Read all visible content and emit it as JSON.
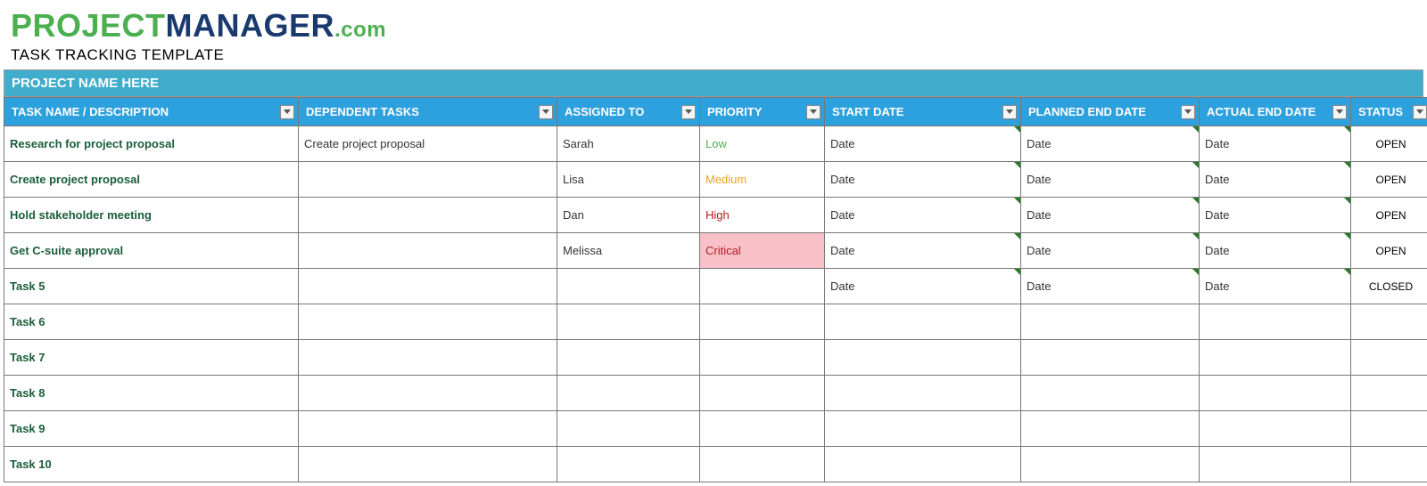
{
  "logo": {
    "project": "PROJECT",
    "manager": "MANAGER",
    "dotcom": ".com"
  },
  "subtitle": "TASK TRACKING TEMPLATE",
  "project_banner": "PROJECT NAME HERE",
  "columns": {
    "task": "TASK NAME / DESCRIPTION",
    "dependent": "DEPENDENT TASKS",
    "assigned": "ASSIGNED TO",
    "priority": "PRIORITY",
    "start": "START DATE",
    "planned": "PLANNED END DATE",
    "actual": "ACTUAL END DATE",
    "status": "STATUS"
  },
  "rows": [
    {
      "task": "Research for project proposal",
      "dependent": "Create project proposal",
      "assigned": "Sarah",
      "priority": "Low",
      "priority_level": "low",
      "start": "Date",
      "planned": "Date",
      "actual": "Date",
      "status": "OPEN",
      "has_ticks": true
    },
    {
      "task": "Create project proposal",
      "dependent": "",
      "assigned": "Lisa",
      "priority": "Medium",
      "priority_level": "medium",
      "start": "Date",
      "planned": "Date",
      "actual": "Date",
      "status": "OPEN",
      "has_ticks": true
    },
    {
      "task": "Hold stakeholder meeting",
      "dependent": "",
      "assigned": "Dan",
      "priority": "High",
      "priority_level": "high",
      "start": "Date",
      "planned": "Date",
      "actual": "Date",
      "status": "OPEN",
      "has_ticks": true
    },
    {
      "task": "Get C-suite approval",
      "dependent": "",
      "assigned": "Melissa",
      "priority": "Critical",
      "priority_level": "critical",
      "start": "Date",
      "planned": "Date",
      "actual": "Date",
      "status": "OPEN",
      "has_ticks": true
    },
    {
      "task": "Task 5",
      "dependent": "",
      "assigned": "",
      "priority": "",
      "priority_level": "",
      "start": "Date",
      "planned": "Date",
      "actual": "Date",
      "status": "CLOSED",
      "has_ticks": true
    },
    {
      "task": "Task 6",
      "dependent": "",
      "assigned": "",
      "priority": "",
      "priority_level": "",
      "start": "",
      "planned": "",
      "actual": "",
      "status": "",
      "has_ticks": false
    },
    {
      "task": "Task 7",
      "dependent": "",
      "assigned": "",
      "priority": "",
      "priority_level": "",
      "start": "",
      "planned": "",
      "actual": "",
      "status": "",
      "has_ticks": false
    },
    {
      "task": "Task 8",
      "dependent": "",
      "assigned": "",
      "priority": "",
      "priority_level": "",
      "start": "",
      "planned": "",
      "actual": "",
      "status": "",
      "has_ticks": false
    },
    {
      "task": "Task 9",
      "dependent": "",
      "assigned": "",
      "priority": "",
      "priority_level": "",
      "start": "",
      "planned": "",
      "actual": "",
      "status": "",
      "has_ticks": false
    },
    {
      "task": "Task 10",
      "dependent": "",
      "assigned": "",
      "priority": "",
      "priority_level": "",
      "start": "",
      "planned": "",
      "actual": "",
      "status": "",
      "has_ticks": false
    }
  ]
}
